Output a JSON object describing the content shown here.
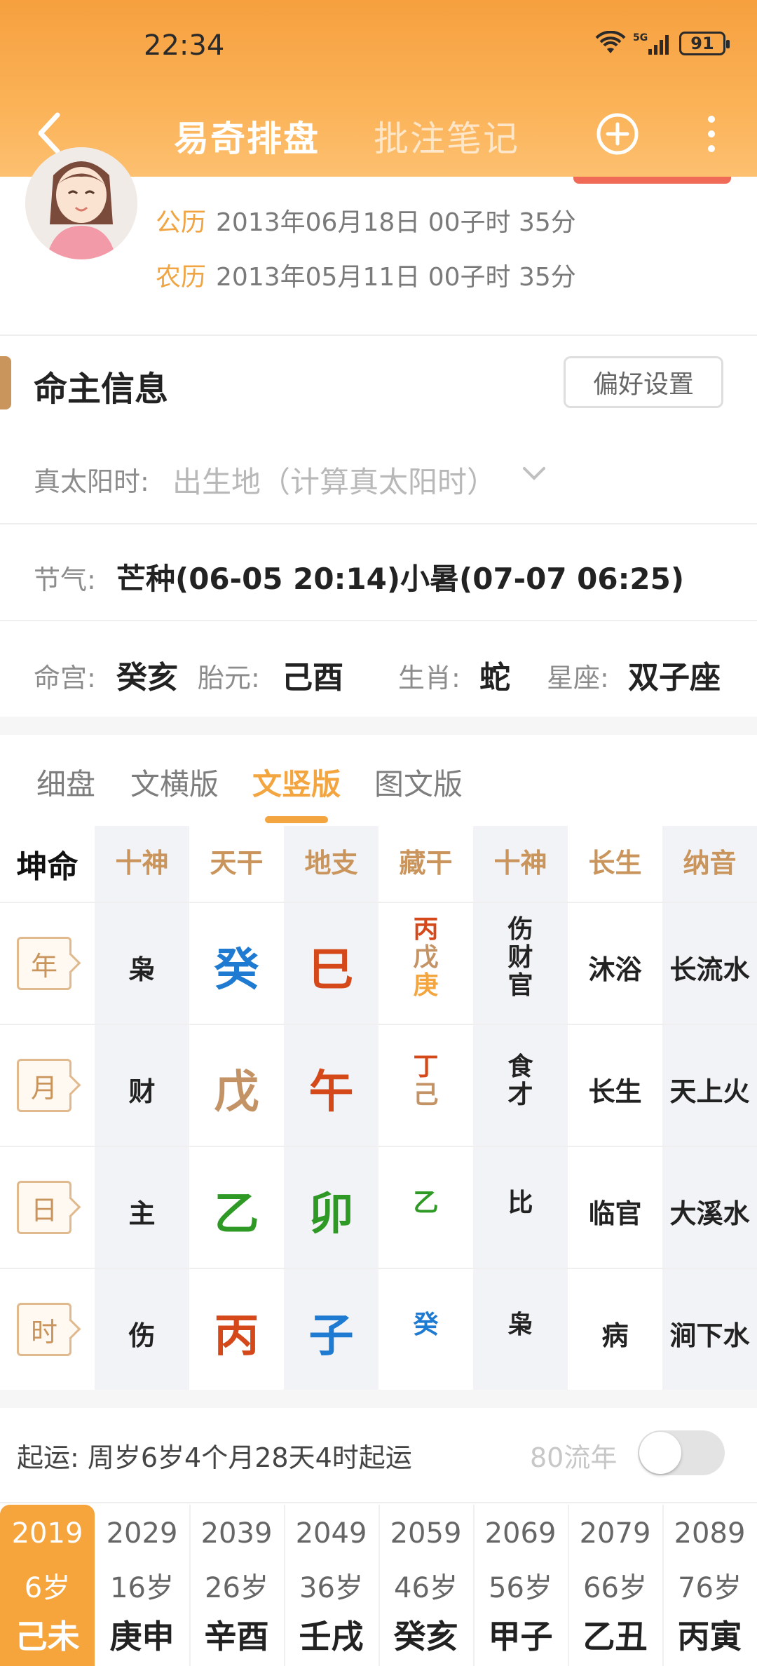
{
  "status": {
    "time": "22:34",
    "network": "5G",
    "battery": "91"
  },
  "nav": {
    "title": "易奇排盘",
    "notes": "批注笔记"
  },
  "header": {
    "solar_label": "公历",
    "solar_value": "2013年06月18日 00子时 35分",
    "lunar_label": "农历",
    "lunar_value": "2013年05月11日 00子时 35分"
  },
  "section": {
    "title": "命主信息",
    "pref_button": "偏好设置"
  },
  "solar_time": {
    "label": "真太阳时:",
    "value": "出生地（计算真太阳时）"
  },
  "jieqi": {
    "label": "节气:",
    "value": "芒种(06-05 20:14)小暑(07-07 06:25)"
  },
  "info": {
    "minggong_label": "命宫:",
    "minggong": "癸亥",
    "taiyuan_label": "胎元:",
    "taiyuan": "己酉",
    "shengxiao_label": "生肖:",
    "shengxiao": "蛇",
    "xingzuo_label": "星座:",
    "xingzuo": "双子座"
  },
  "tabs": [
    "细盘",
    "文横版",
    "文竖版",
    "图文版"
  ],
  "active_tab": "文竖版",
  "table": {
    "corner": "坤命",
    "headers": [
      "十神",
      "天干",
      "地支",
      "藏干",
      "十神",
      "长生",
      "纳音"
    ],
    "rows": [
      {
        "pillar": "年",
        "shishen": "枭",
        "gan": "癸",
        "zhi": "巳",
        "canggan": [
          "丙",
          "戊",
          "庚"
        ],
        "canggan_shishen": [
          "伤",
          "财",
          "官"
        ],
        "changsheng": "沐浴",
        "nayin": "长流水"
      },
      {
        "pillar": "月",
        "shishen": "财",
        "gan": "戊",
        "zhi": "午",
        "canggan": [
          "丁",
          "己"
        ],
        "canggan_shishen": [
          "食",
          "才"
        ],
        "changsheng": "长生",
        "nayin": "天上火"
      },
      {
        "pillar": "日",
        "shishen": "主",
        "gan": "乙",
        "zhi": "卯",
        "canggan": [
          "乙"
        ],
        "canggan_shishen": [
          "比"
        ],
        "changsheng": "临官",
        "nayin": "大溪水"
      },
      {
        "pillar": "时",
        "shishen": "伤",
        "gan": "丙",
        "zhi": "子",
        "canggan": [
          "癸"
        ],
        "canggan_shishen": [
          "枭"
        ],
        "changsheng": "病",
        "nayin": "涧下水"
      }
    ],
    "colors": {
      "water": "#1f7ad1",
      "fire": "#d4481a",
      "earth": "#c39366",
      "wood": "#2e9a25",
      "metal": "#f3a540"
    }
  },
  "qiyun": {
    "text": "起运:  周岁6岁4个月28天4时起运",
    "liunian_label": "80流年",
    "toggle_on": false
  },
  "dayun": [
    {
      "year": "2019",
      "age": "6岁",
      "ganzhi": "己未",
      "active": true
    },
    {
      "year": "2029",
      "age": "16岁",
      "ganzhi": "庚申"
    },
    {
      "year": "2039",
      "age": "26岁",
      "ganzhi": "辛酉"
    },
    {
      "year": "2049",
      "age": "36岁",
      "ganzhi": "壬戌"
    },
    {
      "year": "2059",
      "age": "46岁",
      "ganzhi": "癸亥"
    },
    {
      "year": "2069",
      "age": "56岁",
      "ganzhi": "甲子"
    },
    {
      "year": "2079",
      "age": "66岁",
      "ganzhi": "乙丑"
    },
    {
      "year": "2089",
      "age": "76岁",
      "ganzhi": "丙寅"
    }
  ]
}
